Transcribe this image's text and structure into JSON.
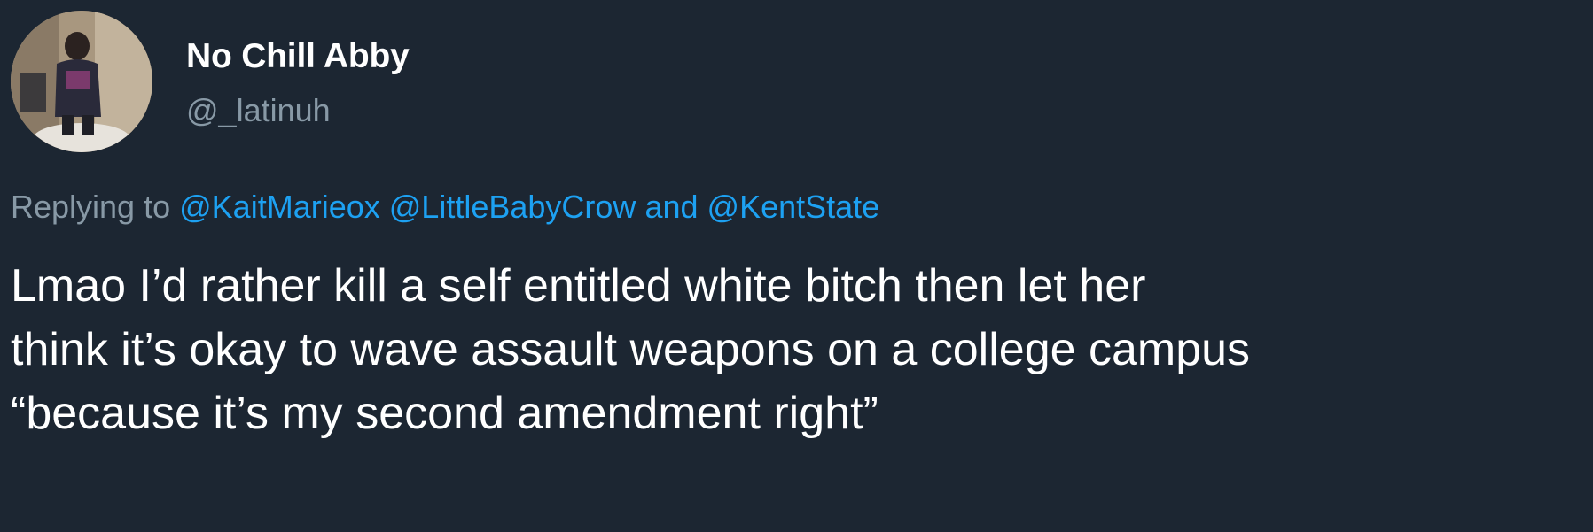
{
  "tweet": {
    "author": {
      "display_name": "No Chill Abby",
      "handle": "@_latinuh",
      "avatar_icon": "profile-photo"
    },
    "reply": {
      "prefix": "Replying to",
      "mentions": [
        "@KaitMarieox",
        "@LittleBabyCrow"
      ],
      "conjunction": "and",
      "last_mention": "@KentState"
    },
    "body_lines": [
      "Lmao I’d rather kill a self entitled white bitch then let her",
      "think it’s okay to wave assault weapons on a college campus",
      "“because it’s my second amendment right”"
    ]
  },
  "colors": {
    "background": "#1c2632",
    "text": "#ffffff",
    "secondary_text": "#8899a6",
    "link": "#1da1f2"
  }
}
